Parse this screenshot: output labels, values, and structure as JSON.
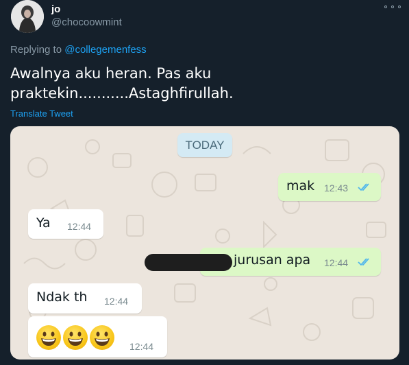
{
  "tweet": {
    "display_name": "jo",
    "handle": "@chocoowmint",
    "replying_prefix": "Replying to",
    "replying_to": "@collegemenfess",
    "text_line1": "Awalnya aku heran. Pas aku",
    "text_line2": "praktekin...........Astaghfirullah.",
    "translate_label": "Translate Tweet"
  },
  "chat": {
    "date_chip": "TODAY",
    "messages": [
      {
        "direction": "out",
        "text": "mak",
        "time": "12:43",
        "status": "read"
      },
      {
        "direction": "in",
        "text": "Ya",
        "time": "12:44"
      },
      {
        "direction": "out",
        "text": "jurusan apa",
        "time": "12:44",
        "status": "read",
        "redacted_prefix": true
      },
      {
        "direction": "in",
        "text": "Ndak th",
        "time": "12:44"
      },
      {
        "direction": "in",
        "text": "",
        "emoji": "grinning-face x3",
        "time": "12:44"
      }
    ]
  },
  "colors": {
    "background": "#15202b",
    "link": "#1da1f2",
    "muted": "#8899a6",
    "chat_wallpaper": "#ece5dd",
    "outgoing_bubble": "#dcf8c6",
    "incoming_bubble": "#ffffff",
    "read_ticks": "#4fb6ec"
  }
}
